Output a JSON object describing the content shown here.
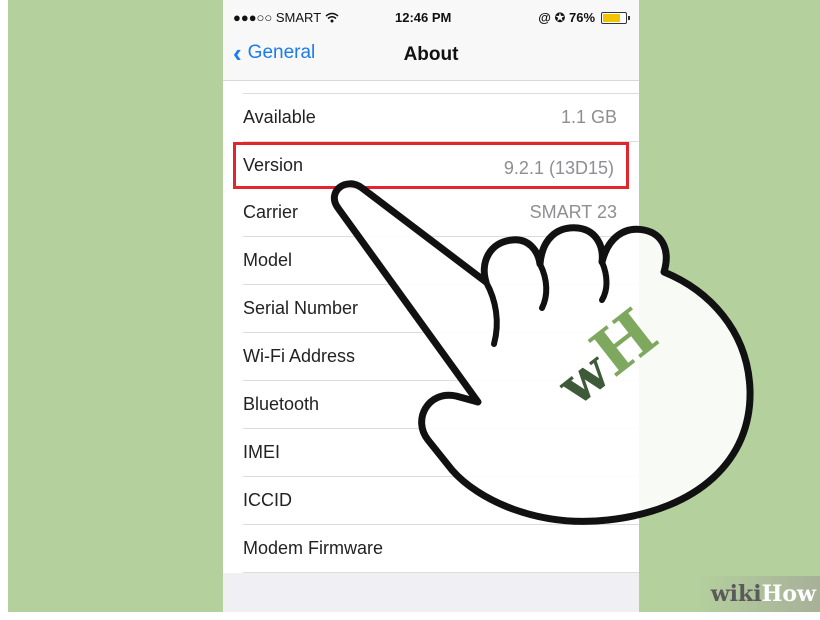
{
  "status_bar": {
    "carrier": "●●●○○ SMART",
    "time": "12:46 PM",
    "indicators": "@ ✪ 76%"
  },
  "nav": {
    "back_label": "General",
    "title": "About"
  },
  "rows": [
    {
      "label": "Available",
      "value": "1.1 GB"
    },
    {
      "label": "Version",
      "value": "9.2.1 (13D15)"
    },
    {
      "label": "Carrier",
      "value": "SMART 23"
    },
    {
      "label": "Model",
      "value": ""
    },
    {
      "label": "Serial Number",
      "value": ""
    },
    {
      "label": "Wi-Fi Address",
      "value": ""
    },
    {
      "label": "Bluetooth",
      "value": ""
    },
    {
      "label": "IMEI",
      "value": ""
    },
    {
      "label": "ICCID",
      "value": ""
    },
    {
      "label": "Modem Firmware",
      "value": ""
    }
  ],
  "overlay": {
    "hand_logo": "wH",
    "watermark_wiki": "wiki",
    "watermark_how": "How"
  },
  "colors": {
    "background": "#b4d09d",
    "ios_blue": "#1a7cf0",
    "highlight_red": "#e2262d",
    "logo_dark": "#3e5a39",
    "logo_light": "#7fa85f"
  },
  "icons": {
    "wifi": "wifi-icon",
    "back": "chevron-left-icon",
    "battery": "battery-icon",
    "hand": "pointing-hand-icon"
  }
}
